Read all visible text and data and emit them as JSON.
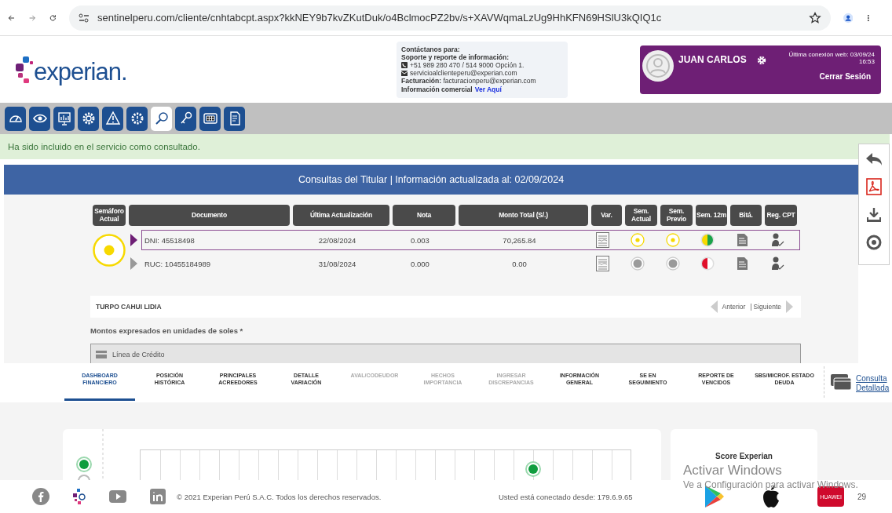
{
  "browser": {
    "url": "sentinelperu.com/cliente/cnhtabcpt.aspx?kkNEY9b7kvZKutDuk/o4BclmocPZ2bv/s+XAVWqmaLzUg9HhKFN69HSlU3kQIQ1c"
  },
  "header": {
    "logo": "experian.",
    "contact": {
      "title": "Contáctanos para:",
      "support": "Soporte y reporte de información:",
      "phone": "+51 989 280 470 / 514 9000 Opción 1.",
      "email": "servicioalclienteperu@experian.com",
      "billing": "**Facturación:** facturacionperu@experian.com",
      "commercial": "Información comercial",
      "commercial_link": "Ver Aquí"
    },
    "user": {
      "name": "JUAN CARLOS",
      "last_connection": "Última conexión web: 03/09/24",
      "last_time": "16:53",
      "logout": "Cerrar Sesión"
    }
  },
  "toolbar": [
    {
      "kind": "gauge",
      "selected": false
    },
    {
      "kind": "eye",
      "selected": false
    },
    {
      "kind": "chart",
      "selected": false
    },
    {
      "kind": "gear",
      "selected": false
    },
    {
      "kind": "warning",
      "selected": false
    },
    {
      "kind": "gear-alert",
      "selected": false
    },
    {
      "kind": "search",
      "selected": true
    },
    {
      "kind": "key",
      "selected": false
    },
    {
      "kind": "grid",
      "selected": false
    },
    {
      "kind": "document",
      "selected": false
    }
  ],
  "notice": "Ha sido incluido en el servicio como consultado.",
  "title_bar": "Consultas del Titular | Información actualizada al: 02/09/2024",
  "table": {
    "columns": [
      "Semáforo\nActual",
      "Documento",
      "Última Actualización",
      "Nota",
      "Monto Total (S/.)",
      "Var.",
      "Sem.\nActual",
      "Sem.\nPrevio",
      "Sem. 12m",
      "Bitá.",
      "Reg. CPT"
    ],
    "semaforo_actual": {
      "color": "#f7d900"
    },
    "rows": [
      {
        "document": "DNI: 45518498",
        "updated": "22/08/2024",
        "nota": "0.003",
        "monto": "70,265.84",
        "sem_actual": {
          "color": "#f7d900"
        },
        "sem_previo": {
          "color": "#f7d900"
        },
        "sem_12m": [
          {
            "color": "#f7d900"
          },
          {
            "color": "#1aa34a"
          }
        ],
        "selected": true
      },
      {
        "document": "RUC: 10455184989",
        "updated": "31/08/2024",
        "nota": "0.000",
        "monto": "0.00",
        "sem_actual": {
          "color": "#9a9a9a"
        },
        "sem_previo": {
          "color": "#9a9a9a"
        },
        "sem_12m": [
          {
            "color": "#e0102a"
          },
          {
            "color": "#ffffff"
          }
        ],
        "selected": false
      }
    ]
  },
  "person": {
    "name": "TURPO CAHUI LIDIA",
    "previous": "Anterior",
    "separator": "|",
    "next": "Siguiente"
  },
  "amounts_note": "Montos expresados en unidades de soles *",
  "credit_line": "Línea de Crédito",
  "tabs": [
    {
      "label": "DASHBOARD\nFINANCIERO",
      "selected": true,
      "disabled": false
    },
    {
      "label": "POSICIÓN\nHISTÓRICA",
      "selected": false,
      "disabled": false
    },
    {
      "label": "PRINCIPALES\nACREEDORES",
      "selected": false,
      "disabled": false
    },
    {
      "label": "DETALLE\nVARIACIÓN",
      "selected": false,
      "disabled": false
    },
    {
      "label": "AVAL/CODEUDOR",
      "selected": false,
      "disabled": true
    },
    {
      "label": "HECHOS\nIMPORTANCIA",
      "selected": false,
      "disabled": true
    },
    {
      "label": "INGRESAR\nDISCREPANCIAS",
      "selected": false,
      "disabled": true
    },
    {
      "label": "INFORMACIÓN\nGENERAL",
      "selected": false,
      "disabled": false
    },
    {
      "label": "SE EN\nSEGUIMIENTO",
      "selected": false,
      "disabled": false
    },
    {
      "label": "REPORTE DE\nVENCIDOS",
      "selected": false,
      "disabled": false
    },
    {
      "label": "SBS/MICROF. ESTADO\nDEUDA",
      "selected": false,
      "disabled": false
    }
  ],
  "detail_link": "Consulta\nDetallada",
  "score_card": {
    "title": "Score Experian"
  },
  "footer": {
    "copyright": "© 2021 Experian Perú S.A.C. Todos los derechos reservados.",
    "connection": "Usted está conectado desde: 179.6.9.65",
    "huawei": "HUAWEI",
    "count": "29"
  },
  "windows_notice": {
    "title": "Activar Windows",
    "text": "Ve a Configuración para activar Windows."
  }
}
